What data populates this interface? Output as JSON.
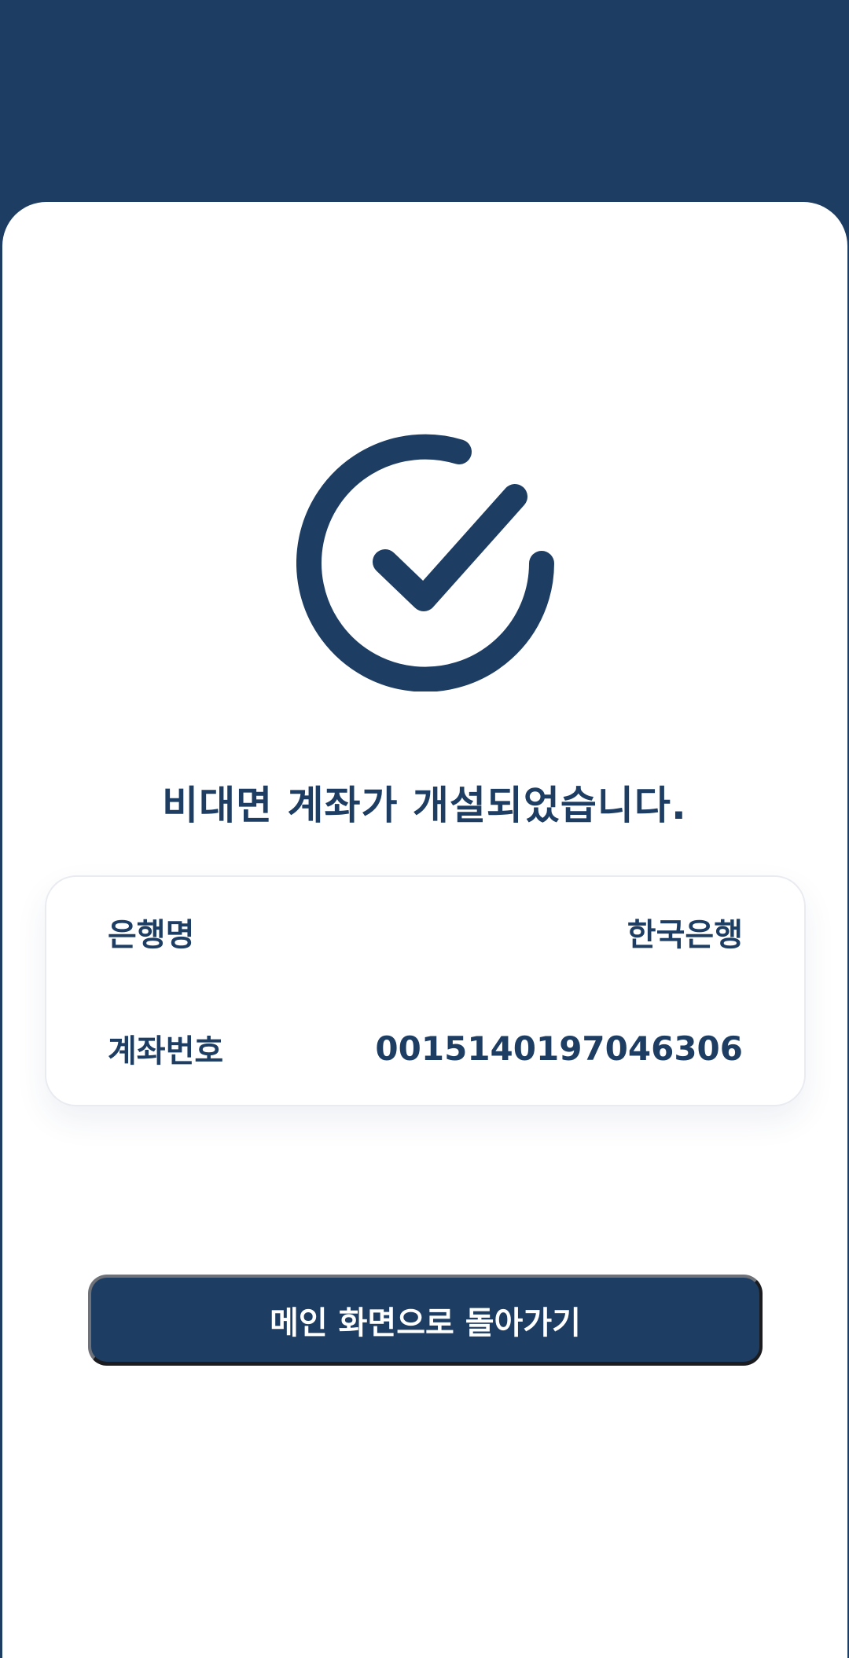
{
  "result": {
    "title": "비대면 계좌가 개설되었습니다.",
    "icon": "check-circle-icon",
    "accent_color": "#1d3d63"
  },
  "account_info": {
    "bank_label": "은행명",
    "bank_value": "한국은행",
    "account_label": "계좌번호",
    "account_value": "0015140197046306"
  },
  "actions": {
    "home_label": "메인 화면으로 돌아가기"
  }
}
